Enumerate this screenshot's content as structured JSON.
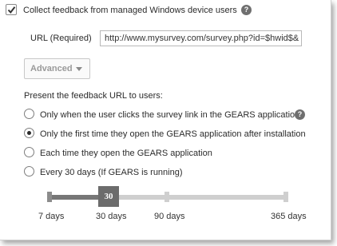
{
  "collect": {
    "label": "Collect feedback from managed Windows device users",
    "checked": true,
    "help": "?"
  },
  "url": {
    "label": "URL (Required)",
    "value": "http://www.mysurvey.com/survey.php?id=$hwid$&"
  },
  "advanced": {
    "label": "Advanced"
  },
  "present": {
    "heading": "Present the feedback URL to users:",
    "options": [
      {
        "label": "Only when the user clicks the survey link in the GEARS application",
        "selected": false,
        "help": "?"
      },
      {
        "label": "Only the first time they open the GEARS application after installation",
        "selected": true
      },
      {
        "label": "Each time they open the GEARS application",
        "selected": false
      },
      {
        "label": "Every 30 days (If GEARS is running)",
        "selected": false
      }
    ]
  },
  "slider": {
    "value_label": "30",
    "ticks": [
      "7 days",
      "30 days",
      "90 days",
      "365 days"
    ],
    "selected_index": 1
  }
}
